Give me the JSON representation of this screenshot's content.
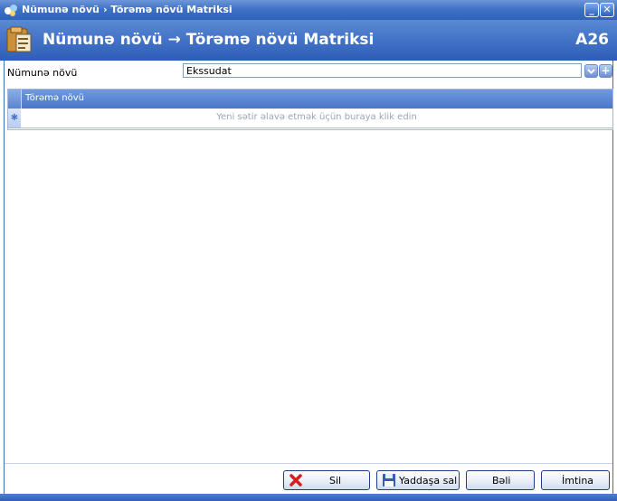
{
  "window": {
    "title_primary": "Nümunə növü",
    "title_secondary": "› Törəmə növü Matriksi",
    "minimize_glyph": "_",
    "close_glyph": "✕"
  },
  "banner": {
    "title": "Nümunə növü → Törəmə növü Matriksi",
    "code": "A26",
    "icon": "folder-document-icon"
  },
  "form": {
    "label": "Nümunə növü",
    "value": "Ekssudat",
    "dropdown_icon": "chevron-down-icon",
    "add_glyph": "+"
  },
  "grid": {
    "columns": [
      "Törəmə növü"
    ],
    "new_row_marker": "✱",
    "new_row_hint": "Yeni sətir əlavə etmək üçün buraya klik edin",
    "rows": []
  },
  "buttons": {
    "delete": "Sil",
    "save": "Yaddaşa sal",
    "ok": "Bəli",
    "cancel": "İmtina"
  },
  "colors": {
    "title_bar": "#3c6fc4",
    "banner": "#2c5eb8",
    "grid_header": "#5a86d2",
    "hint_text": "#9aa5b8"
  }
}
